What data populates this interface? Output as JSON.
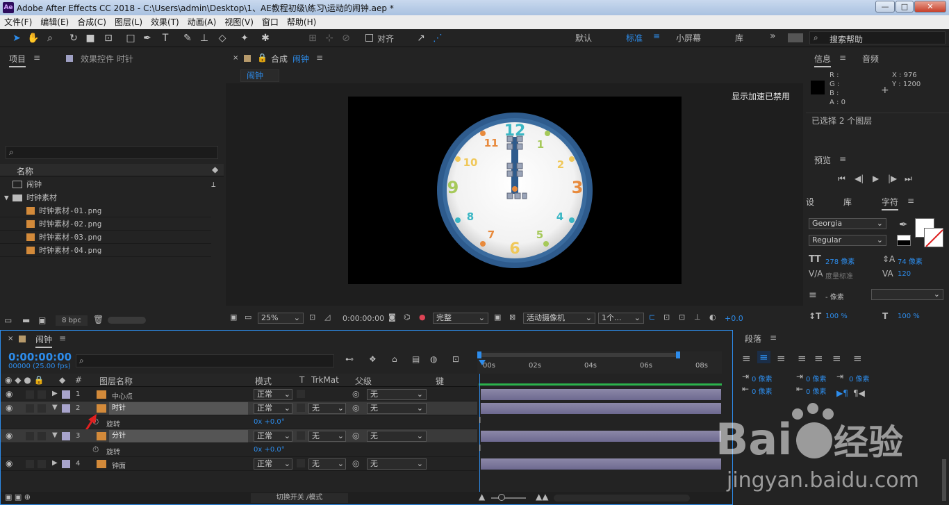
{
  "app": {
    "icon": "Ae",
    "title": "Adobe After Effects CC 2018 - C:\\Users\\admin\\Desktop\\1、AE教程初级\\练习\\运动的闹钟.aep *",
    "minimize": "—",
    "maximize": "□",
    "close": "✕"
  },
  "menu": [
    "文件(F)",
    "编辑(E)",
    "合成(C)",
    "图层(L)",
    "效果(T)",
    "动画(A)",
    "视图(V)",
    "窗口",
    "帮助(H)"
  ],
  "toolbar": {
    "snap_label": "对齐",
    "workspaces": [
      "默认",
      "标准",
      "小屏幕",
      "库"
    ],
    "search_placeholder": "搜索帮助"
  },
  "project": {
    "tab": "项目",
    "effects_tab": "效果控件 时针",
    "col_name": "名称",
    "items": [
      "闹钟",
      "时钟素材",
      "时钟素材-01.png",
      "时钟素材-02.png",
      "时钟素材-03.png",
      "时钟素材-04.png"
    ],
    "bpc": "8 bpc"
  },
  "comp": {
    "tab_prefix": "合成",
    "tab_name": "闹钟",
    "sub_tab": "闹钟",
    "accel_msg": "显示加速已禁用",
    "zoom": "25%",
    "time": "0:00:00:00",
    "quality": "完整",
    "camera": "活动摄像机",
    "views": "1个...",
    "exposure": "+0.0"
  },
  "clock": {
    "numbers": [
      "12",
      "1",
      "2",
      "3",
      "4",
      "5",
      "6",
      "7",
      "8",
      "9",
      "10",
      "11"
    ]
  },
  "info": {
    "tab": "信息",
    "audio_tab": "音频",
    "r": "R :",
    "g": "G :",
    "b": "B :",
    "a": "A : 0",
    "x": "X : 976",
    "y": "Y : 1200",
    "selected": "已选择 2 个图层"
  },
  "preview": {
    "tab": "预览"
  },
  "character": {
    "tabs": [
      "设",
      "库",
      "字符"
    ],
    "font": "Georgia",
    "style": "Regular",
    "size": "278 像素",
    "leading": "74 像素",
    "kerning": "度量标准",
    "tracking": "120",
    "stroke": "- 像素",
    "vscale": "100 %",
    "hscale": "100 %"
  },
  "timeline": {
    "tab": "闹钟",
    "timecode": "0:00:00:00",
    "fps": "00000 (25.00 fps)",
    "cols": {
      "num": "#",
      "name": "图层名称",
      "mode": "模式",
      "t": "T",
      "trkmat": "TrkMat",
      "parent": "父级",
      "key": "键"
    },
    "ruler": [
      "00s",
      "02s",
      "04s",
      "06s",
      "08s"
    ],
    "toggle": "切换开关 /模式"
  },
  "layers": [
    {
      "num": "1",
      "name": "中心点",
      "mode": "正常",
      "trk": "",
      "parent": "无",
      "color": "#a8a4cc"
    },
    {
      "num": "2",
      "name": "时针",
      "mode": "正常",
      "trk": "无",
      "parent": "无",
      "color": "#a8a4cc"
    },
    {
      "num": "3",
      "name": "分针",
      "mode": "正常",
      "trk": "无",
      "parent": "无",
      "color": "#a8a4cc"
    },
    {
      "num": "4",
      "name": "钟面",
      "mode": "正常",
      "trk": "无",
      "parent": "无",
      "color": "#a8a4cc"
    }
  ],
  "props": {
    "rotate": "旋转",
    "value": "0x +0.0°"
  },
  "paragraph": {
    "tab": "段落",
    "indent": "0 像素"
  },
  "watermark": {
    "url": "jingyan.baidu.com"
  }
}
